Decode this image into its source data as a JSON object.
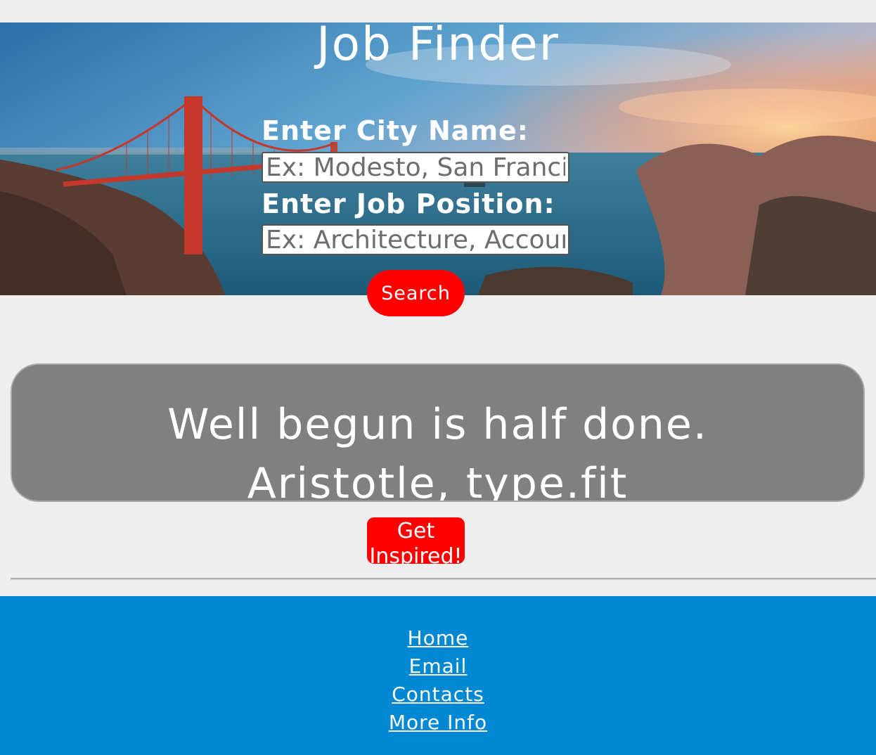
{
  "header": {
    "title": "Job Finder"
  },
  "search_form": {
    "city_label": "Enter City Name:",
    "city_placeholder": "Ex: Modesto, San Francisco",
    "city_value": "",
    "job_label": "Enter Job Position:",
    "job_placeholder": "Ex: Architecture, Accounting",
    "job_value": "",
    "search_button": "Search"
  },
  "quote": {
    "text": "Well begun is half done.",
    "author": "Aristotle, type.fit",
    "button": "Get Inspired!"
  },
  "footer": {
    "links": [
      "Home",
      "Email",
      "Contacts",
      "More Info"
    ]
  },
  "colors": {
    "page_background": "#eeeeee",
    "button_red": "#ff0000",
    "quote_box": "#808080",
    "footer_blue": "#0088d3"
  }
}
